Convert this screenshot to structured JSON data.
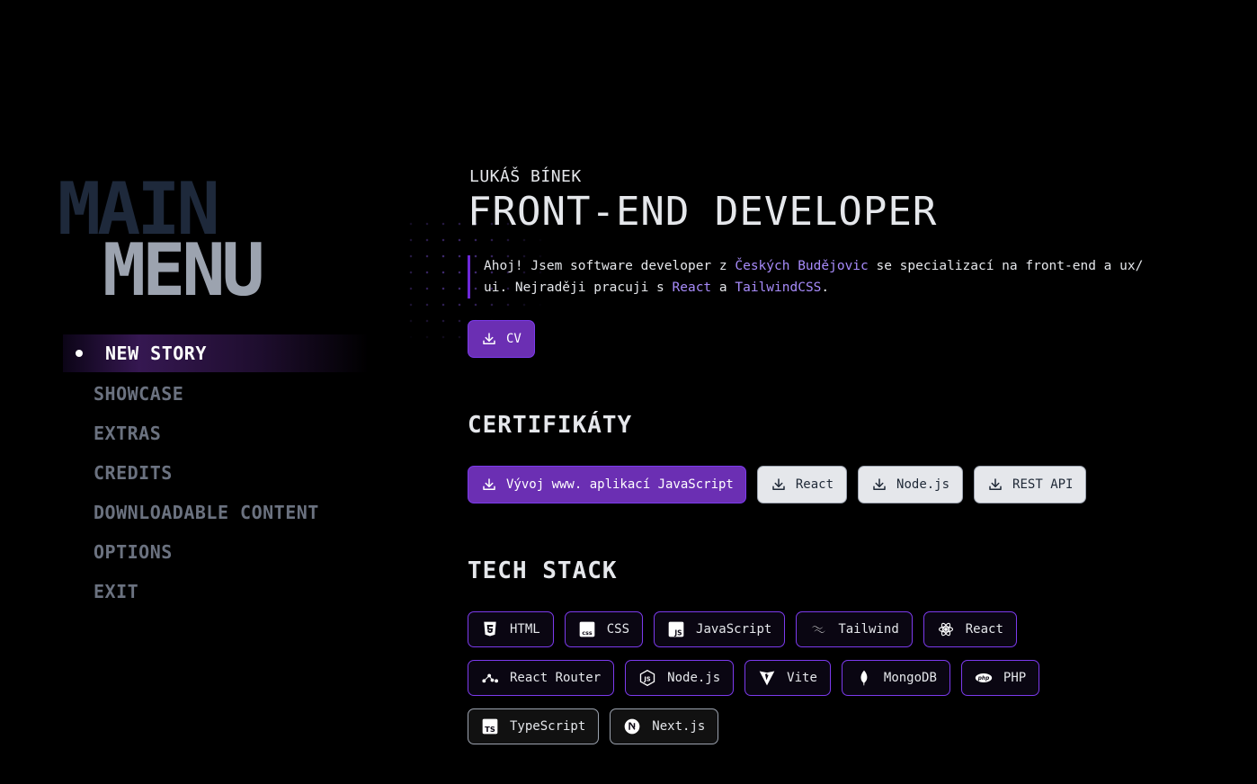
{
  "menu": {
    "title_main": "MAIN",
    "title_menu": "MENU",
    "items": [
      {
        "label": "NEW STORY",
        "active": true
      },
      {
        "label": "SHOWCASE"
      },
      {
        "label": "EXTRAS"
      },
      {
        "label": "CREDITS"
      },
      {
        "label": "DOWNLOADABLE CONTENT"
      },
      {
        "label": "OPTIONS"
      },
      {
        "label": "EXIT"
      }
    ]
  },
  "hero": {
    "name": "LUKÁŠ BÍNEK",
    "title": "FRONT-END DEVELOPER",
    "intro_1": "Ahoj! Jsem software developer z ",
    "intro_city": "Českých Budějovic",
    "intro_2": " se specializací na front-end a ux/ ui. Nejraději pracuji s ",
    "intro_react": "React",
    "intro_3": " a ",
    "intro_tailwind": "TailwindCSS",
    "intro_4": ".",
    "cv_label": "CV"
  },
  "certificates": {
    "title": "CERTIFIKÁTY",
    "items": [
      {
        "label": "Vývoj www. aplikací JavaScript",
        "style": "primary"
      },
      {
        "label": "React",
        "style": "light"
      },
      {
        "label": "Node.js",
        "style": "light"
      },
      {
        "label": "REST API",
        "style": "light"
      }
    ]
  },
  "tech_stack": {
    "title": "TECH STACK",
    "items": [
      {
        "label": "HTML",
        "icon": "html5-icon"
      },
      {
        "label": "CSS",
        "icon": "css3-icon"
      },
      {
        "label": "JavaScript",
        "icon": "javascript-icon"
      },
      {
        "label": "Tailwind",
        "icon": "tailwind-icon"
      },
      {
        "label": "React",
        "icon": "react-icon"
      },
      {
        "label": "React Router",
        "icon": "react-router-icon"
      },
      {
        "label": "Node.js",
        "icon": "nodejs-icon"
      },
      {
        "label": "Vite",
        "icon": "vite-icon"
      },
      {
        "label": "MongoDB",
        "icon": "mongodb-icon"
      },
      {
        "label": "PHP",
        "icon": "php-icon"
      },
      {
        "label": "TypeScript",
        "icon": "typescript-icon"
      },
      {
        "label": "Next.js",
        "icon": "nextjs-icon"
      }
    ]
  },
  "colors": {
    "accent": "#6b2fb3",
    "accent_border": "#7c3aed",
    "highlight_text": "#a78bfa",
    "background": "#000000"
  }
}
